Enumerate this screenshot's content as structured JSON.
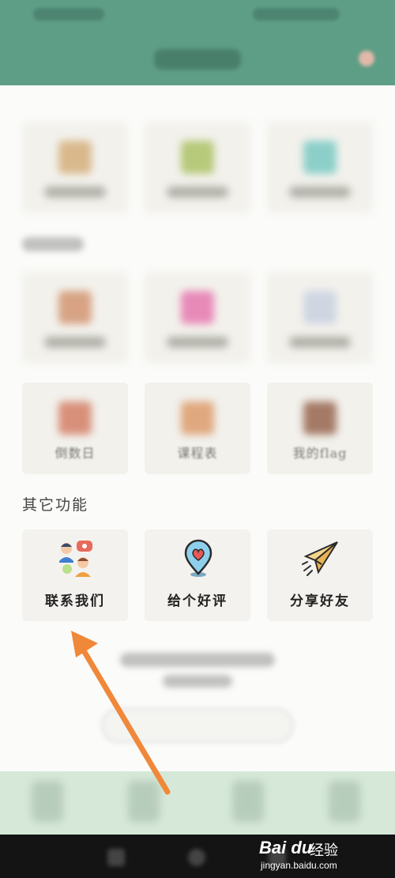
{
  "sections": {
    "other_functions_title": "其它功能"
  },
  "row3_cards": [
    {
      "label": "倒数日"
    },
    {
      "label": "课程表"
    },
    {
      "label": "我的flag"
    }
  ],
  "other_cards": [
    {
      "label": "联系我们",
      "icon": "contact-people-icon"
    },
    {
      "label": "给个好评",
      "icon": "heart-location-icon"
    },
    {
      "label": "分享好友",
      "icon": "paper-plane-icon"
    }
  ],
  "colors": {
    "header": "#5f9e86",
    "tabbar": "#d6e8d8",
    "arrow": "#f0883a"
  },
  "watermark": {
    "logo": "Bai du",
    "text": "经验",
    "url": "jingyan.baidu.com"
  }
}
